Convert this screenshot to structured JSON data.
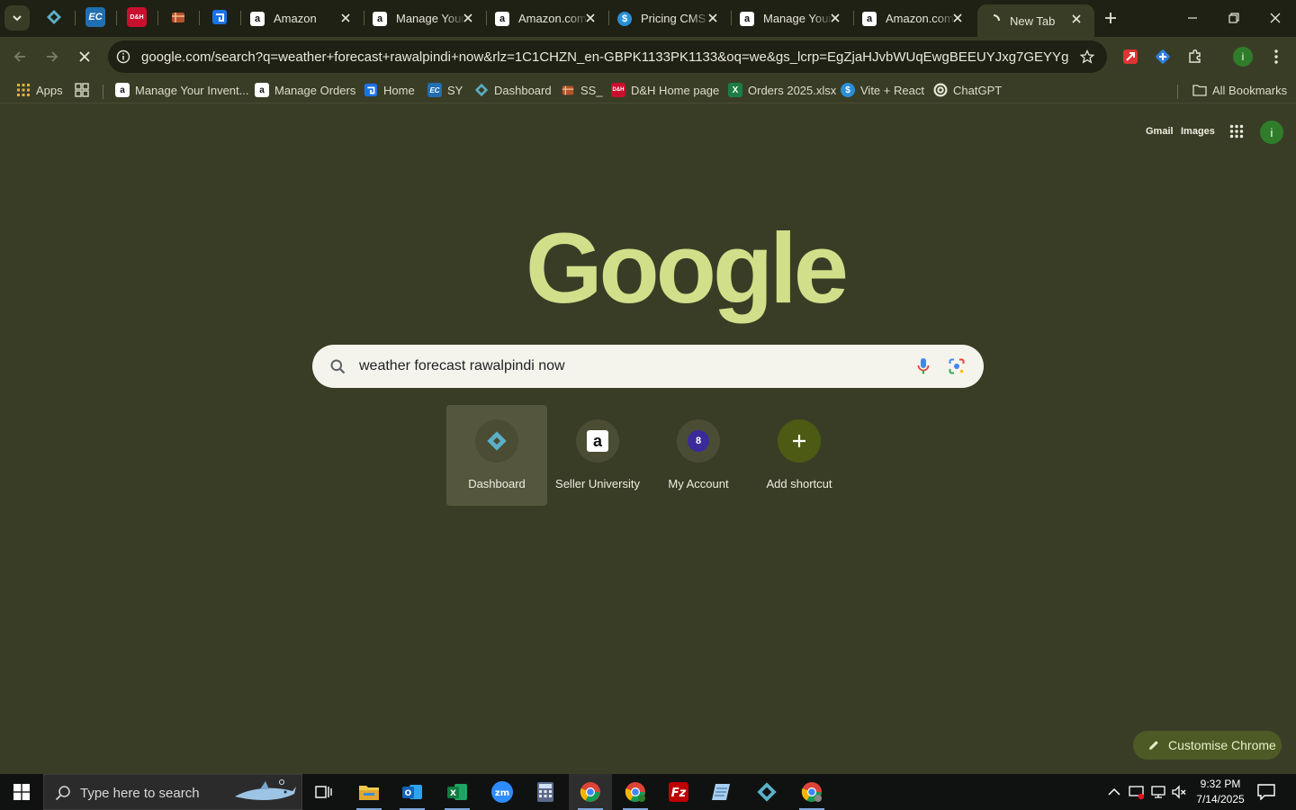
{
  "tabs": [
    {
      "title": "Amazon",
      "favicon": "amazon-icon"
    },
    {
      "title": "Manage Your Inventory",
      "favicon": "amazon-icon"
    },
    {
      "title": "Amazon.com",
      "favicon": "amazon-icon"
    },
    {
      "title": "Pricing CMS",
      "favicon": "dollar-icon"
    },
    {
      "title": "Manage Your Inventory",
      "favicon": "amazon-icon"
    },
    {
      "title": "Amazon.com",
      "favicon": "amazon-icon"
    },
    {
      "title": "New Tab",
      "favicon": "loading-icon",
      "active": true
    }
  ],
  "pinned_tabs": [
    {
      "text": "",
      "icon": "dashboard-diamond-icon",
      "color": "#5ab0c8"
    },
    {
      "text": "EC",
      "icon": "ec-icon",
      "color": "#1f6fb2"
    },
    {
      "text": "D&H",
      "icon": "dh-icon",
      "color": "#c8102e"
    },
    {
      "text": "",
      "icon": "package-icon",
      "color": "#b4522c"
    },
    {
      "text": "",
      "icon": "home-g-icon",
      "color": "#1a73e8"
    }
  ],
  "toolbar": {
    "url": "google.com/search?q=weather+forecast+rawalpindi+now&rlz=1C1CHZN_en-GBPK1133PK1133&oq=we&gs_lcrp=EgZjaHJvbWUqEwgBEEUYJxg7GEYYgAIYgAQYigU...",
    "profile_initial": "i"
  },
  "bookmarks": {
    "apps_label": "Apps",
    "items": [
      {
        "label": "Manage Your Invent...",
        "icon": "amazon-icon"
      },
      {
        "label": "Manage Orders",
        "icon": "amazon-icon"
      },
      {
        "label": "Home",
        "icon": "home-g-icon"
      },
      {
        "label": "SY",
        "icon": "ec-icon"
      },
      {
        "label": "Dashboard",
        "icon": "dashboard-diamond-icon"
      },
      {
        "label": "SS_",
        "icon": "package-icon"
      },
      {
        "label": "D&H Home page",
        "icon": "dh-icon"
      },
      {
        "label": "Orders 2025.xlsx",
        "icon": "excel-icon"
      },
      {
        "label": "Vite + React",
        "icon": "dollar-icon"
      },
      {
        "label": "ChatGPT",
        "icon": "chatgpt-icon"
      }
    ],
    "all_bookmarks_label": "All Bookmarks"
  },
  "ntp": {
    "gmail_label": "Gmail",
    "images_label": "Images",
    "profile_initial": "i",
    "logo_text": "Google",
    "search_query": "weather forecast rawalpindi now",
    "shortcuts": [
      {
        "label": "Dashboard",
        "icon": "dashboard-diamond-icon"
      },
      {
        "label": "Seller University",
        "icon": "amazon-icon"
      },
      {
        "label": "My Account",
        "icon": "account-8-icon",
        "badge": "8"
      },
      {
        "label": "Add shortcut",
        "icon": "plus-icon"
      }
    ],
    "customise_label": "Customise Chrome"
  },
  "taskbar": {
    "search_placeholder": "Type here to search",
    "time": "9:32 PM",
    "date": "7/14/2025"
  },
  "colors": {
    "background": "#3a3d26",
    "tabstrip": "#1f2114",
    "logo": "#d1df8a",
    "customise_button": "#4d5a26"
  }
}
